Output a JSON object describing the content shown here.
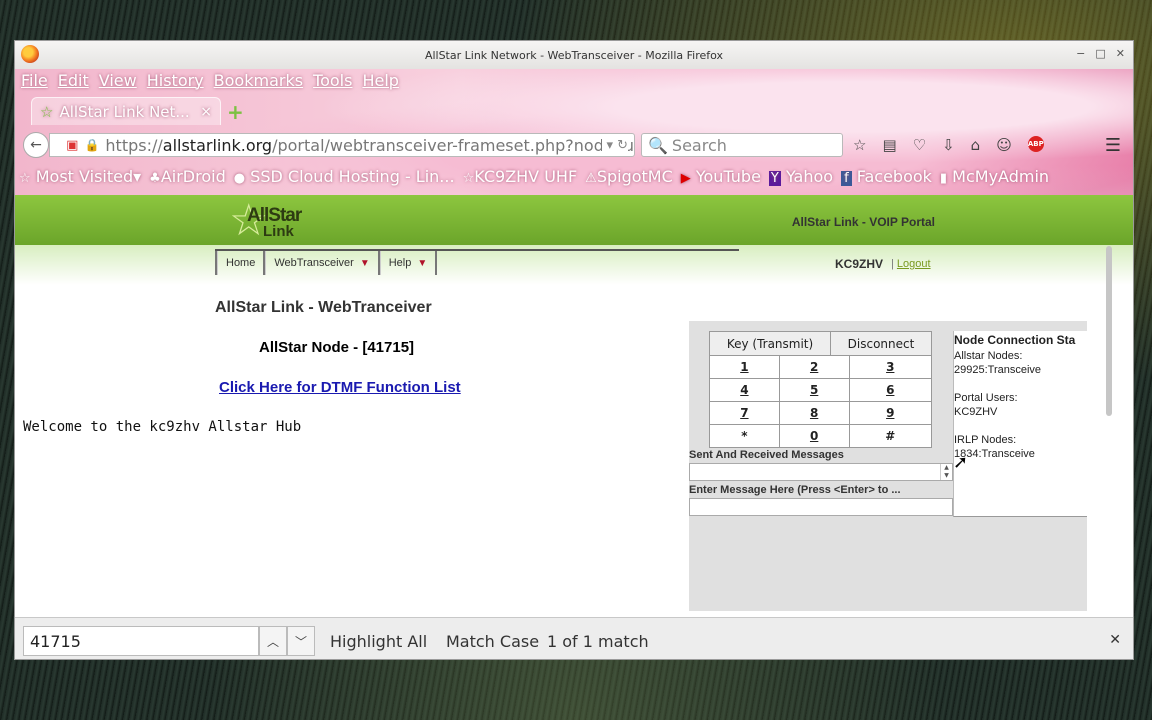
{
  "window": {
    "title": "AllStar Link Network - WebTransceiver - Mozilla Firefox"
  },
  "menu": [
    "File",
    "Edit",
    "View",
    "History",
    "Bookmarks",
    "Tools",
    "Help"
  ],
  "tab": {
    "label": "AllStar Link Net...",
    "close": "×",
    "new": "+"
  },
  "url": {
    "scheme": "https://",
    "host": "allstarlink.org",
    "path": "/portal/webtransceiver-frameset.php?nodenu",
    "search_placeholder": "Search"
  },
  "bookmarks": [
    {
      "icon": "☆",
      "label": "Most Visited▾"
    },
    {
      "icon": "♣",
      "label": "AirDroid"
    },
    {
      "icon": "●",
      "label": "SSD Cloud Hosting - Lin..."
    },
    {
      "icon": "☆",
      "label": "KC9ZHV UHF"
    },
    {
      "icon": "⚠",
      "label": "SpigotMC"
    },
    {
      "icon": "▶",
      "label": "YouTube"
    },
    {
      "icon": "Y",
      "label": "Yahoo"
    },
    {
      "icon": "f",
      "label": "Facebook"
    },
    {
      "icon": "▮",
      "label": "McMyAdmin"
    }
  ],
  "portal": {
    "logo_top": "AllStar",
    "logo_bottom": "Link",
    "header_right": "AllStar Link - VOIP Portal",
    "nav": [
      "Home",
      "WebTransceiver",
      "Help"
    ],
    "user": "KC9ZHV",
    "separator": "|",
    "logout": "Logout"
  },
  "main": {
    "page_title": "AllStar Link - WebTranceiver",
    "node_title": "AllStar Node - [41715]",
    "dtmf_link": "Click Here for DTMF Function List",
    "welcome": "Welcome to the kc9zhv Allstar Hub"
  },
  "transceiver": {
    "key_button": "Key (Transmit)",
    "disconnect_button": "Disconnect",
    "keys": [
      [
        "1",
        "2",
        "3"
      ],
      [
        "4",
        "5",
        "6"
      ],
      [
        "7",
        "8",
        "9"
      ],
      [
        "*",
        "0",
        "#"
      ]
    ],
    "sent_label": "Sent And Received Messages",
    "enter_label": "Enter Message Here (Press <Enter> to ...",
    "status": {
      "heading": "Node Connection Sta",
      "allstar_label": "Allstar Nodes:",
      "allstar_value": "29925:Transceive",
      "portal_label": "Portal Users:",
      "portal_value": "KC9ZHV",
      "irlp_label": "IRLP Nodes:",
      "irlp_value": "1834:Transceive"
    }
  },
  "findbar": {
    "query": "41715",
    "highlight_all": "Highlight All",
    "match_case": "Match Case",
    "result": "1 of 1 match"
  }
}
